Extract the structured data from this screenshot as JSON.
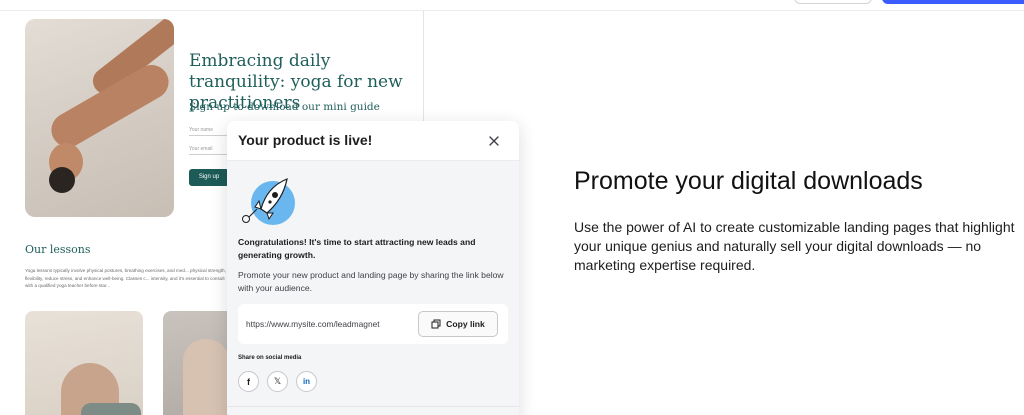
{
  "preview": {
    "hero_title": "Embracing daily tranquility: yoga for new practitioners",
    "hero_subtitle": "Sign up to download our mini guide",
    "name_label": "Your name",
    "email_label": "Your email",
    "signup_label": "Sign up",
    "lessons_title": "Our lessons",
    "lessons_text": "Yoga lessons typically involve physical postures, breathing exercises, and med... physical strength, flexibility, reduce stress, and enhance well-being. Classes c... intensity, and it's essential to consult with a qualified yoga teacher before star..."
  },
  "modal": {
    "title": "Your product is live!",
    "congrats": "Congratulations! It's time to start attracting new leads and generating growth.",
    "promote_text": "Promote your new product and landing page by sharing the link below with your audience.",
    "link_url": "https://www.mysite.com/leadmagnet",
    "copy_label": "Copy link",
    "share_label": "Share on social media",
    "socials": [
      {
        "name": "facebook",
        "glyph": "f"
      },
      {
        "name": "x",
        "glyph": "𝕏"
      },
      {
        "name": "linkedin",
        "glyph": "in"
      }
    ]
  },
  "info": {
    "title": "Promote your digital downloads",
    "description": "Use the power of AI to create customizable landing pages that highlight your unique genius and naturally sell your digital downloads — no marketing expertise required."
  },
  "colors": {
    "brand_teal": "#1f5f5b",
    "primary_blue": "#3b5bfd",
    "accent_light_blue": "#6ab7f0"
  },
  "icons": [
    "close-icon",
    "rocket-icon",
    "copy-icon",
    "facebook-icon",
    "x-icon",
    "linkedin-icon"
  ]
}
